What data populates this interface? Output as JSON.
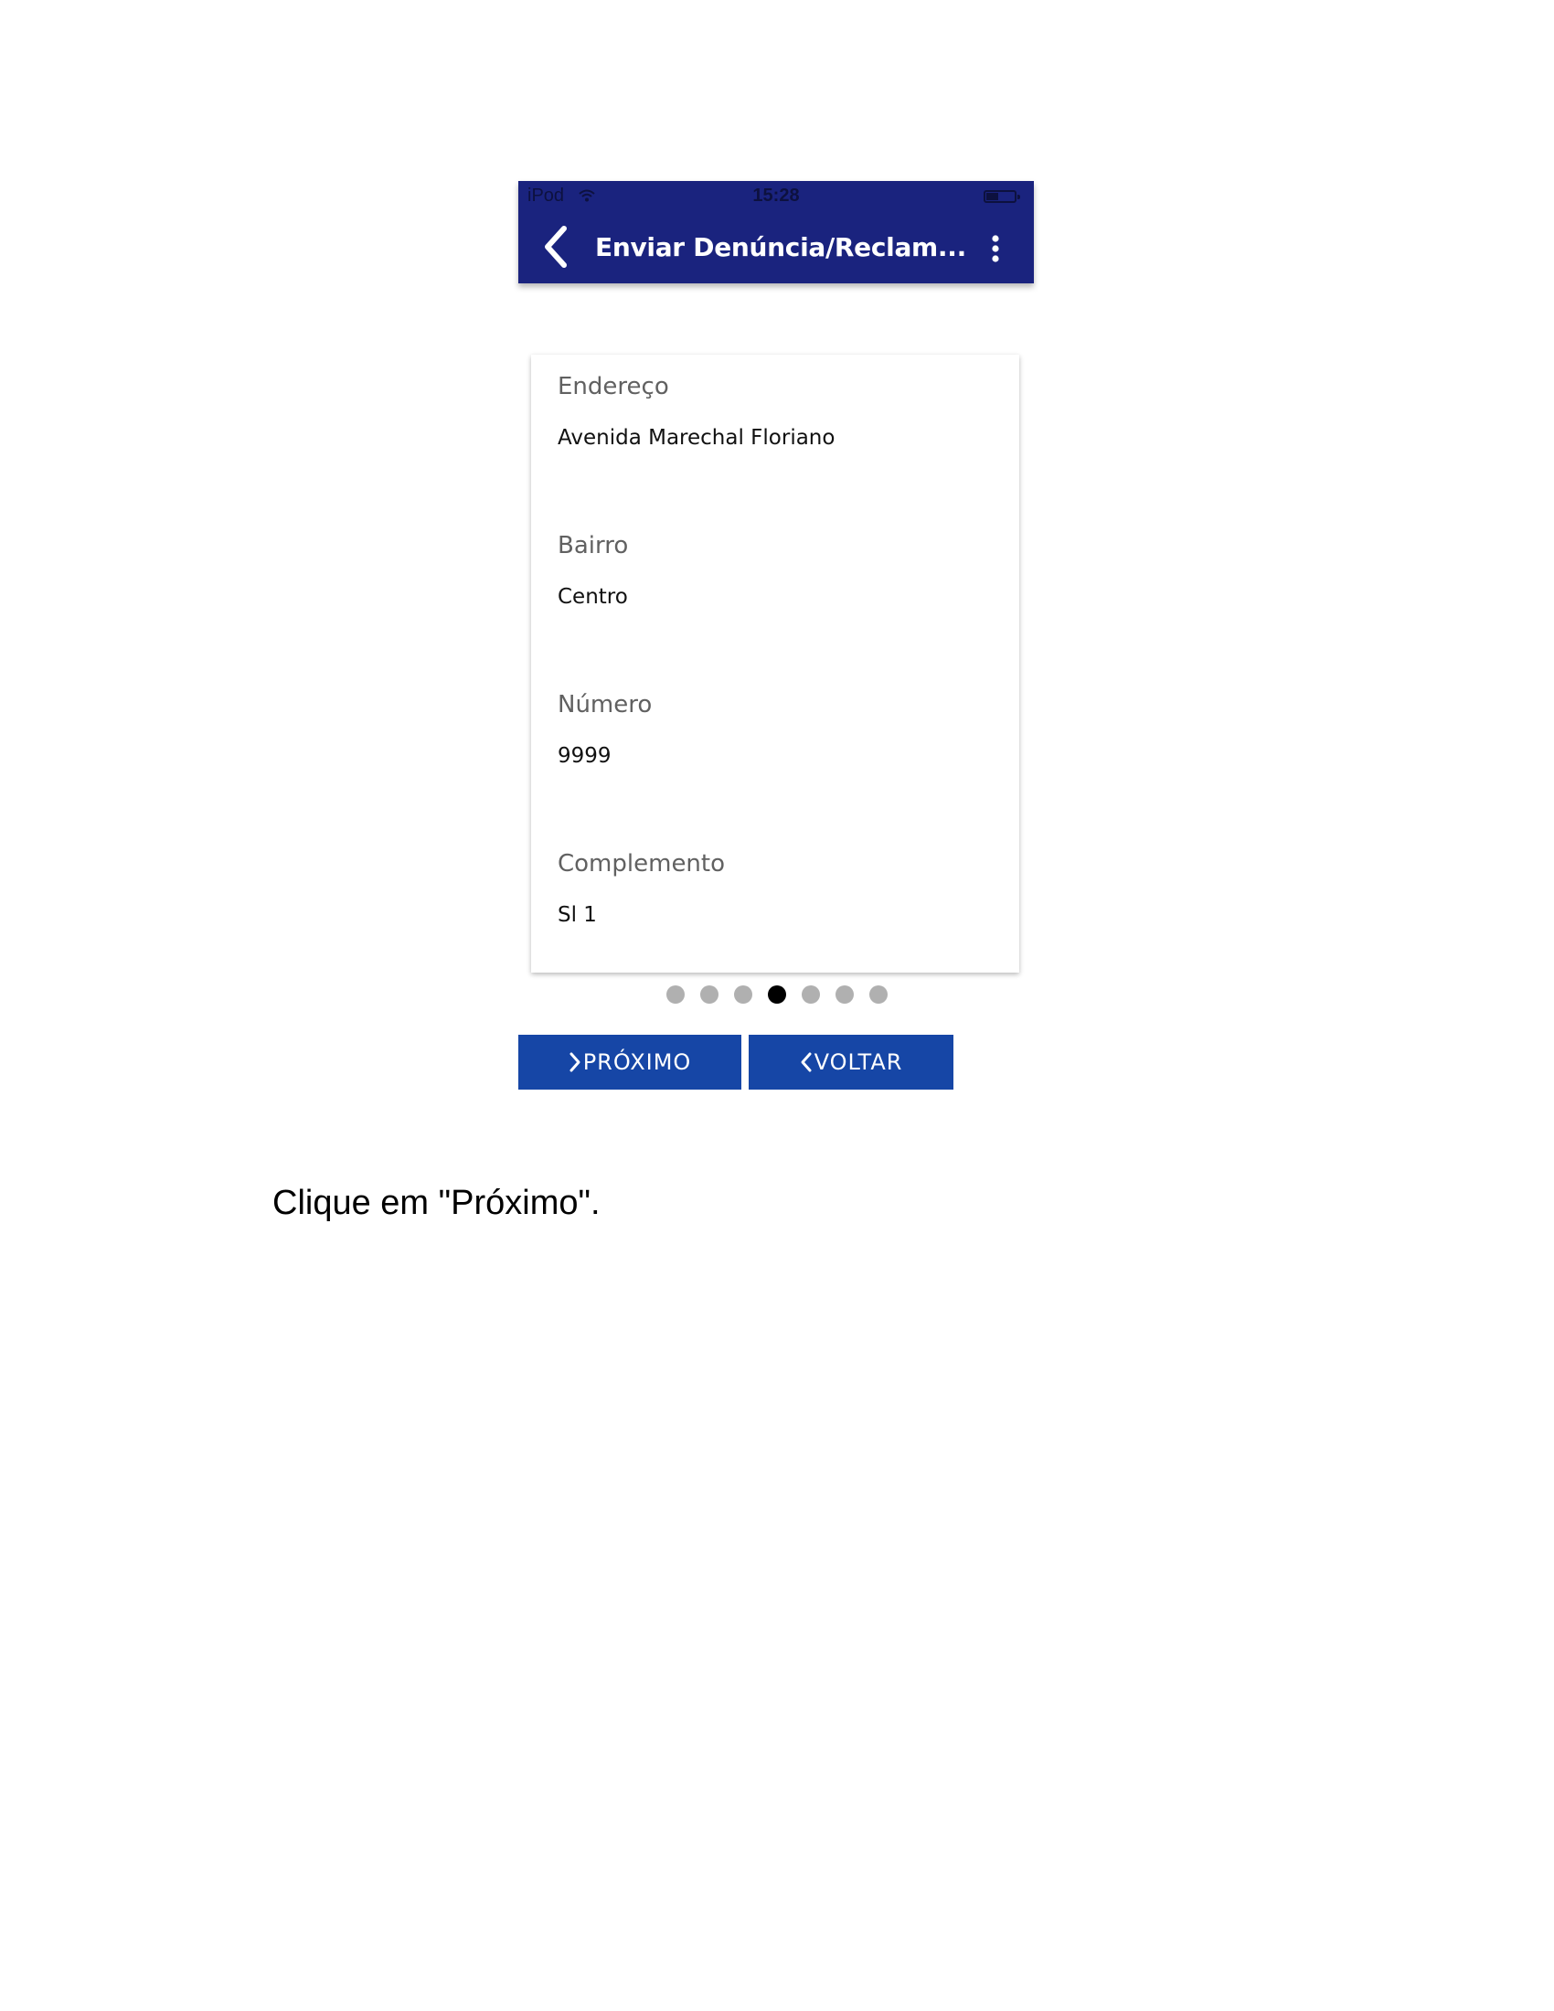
{
  "status_bar": {
    "carrier": "iPod",
    "time": "15:28"
  },
  "app_bar": {
    "title": "Enviar Denúncia/Reclam...",
    "back_icon": "chevron-left-icon",
    "menu_icon": "more-vertical-icon"
  },
  "form": {
    "fields": [
      {
        "label": "Endereço",
        "value": "Avenida Marechal Floriano"
      },
      {
        "label": "Bairro",
        "value": "Centro"
      },
      {
        "label": "Número",
        "value": "9999"
      },
      {
        "label": "Complemento",
        "value": "Sl 1"
      }
    ]
  },
  "pagination": {
    "total_steps": 7,
    "current_step": 4
  },
  "buttons": {
    "next_label": "PRÓXIMO",
    "back_label": "VOLTAR"
  },
  "caption": "Clique em \"Próximo\".",
  "colors": {
    "app_bar": "#1a237e",
    "button": "#1646a6",
    "label": "#616161",
    "dot_inactive": "#b0b0b0",
    "dot_active": "#000000"
  }
}
